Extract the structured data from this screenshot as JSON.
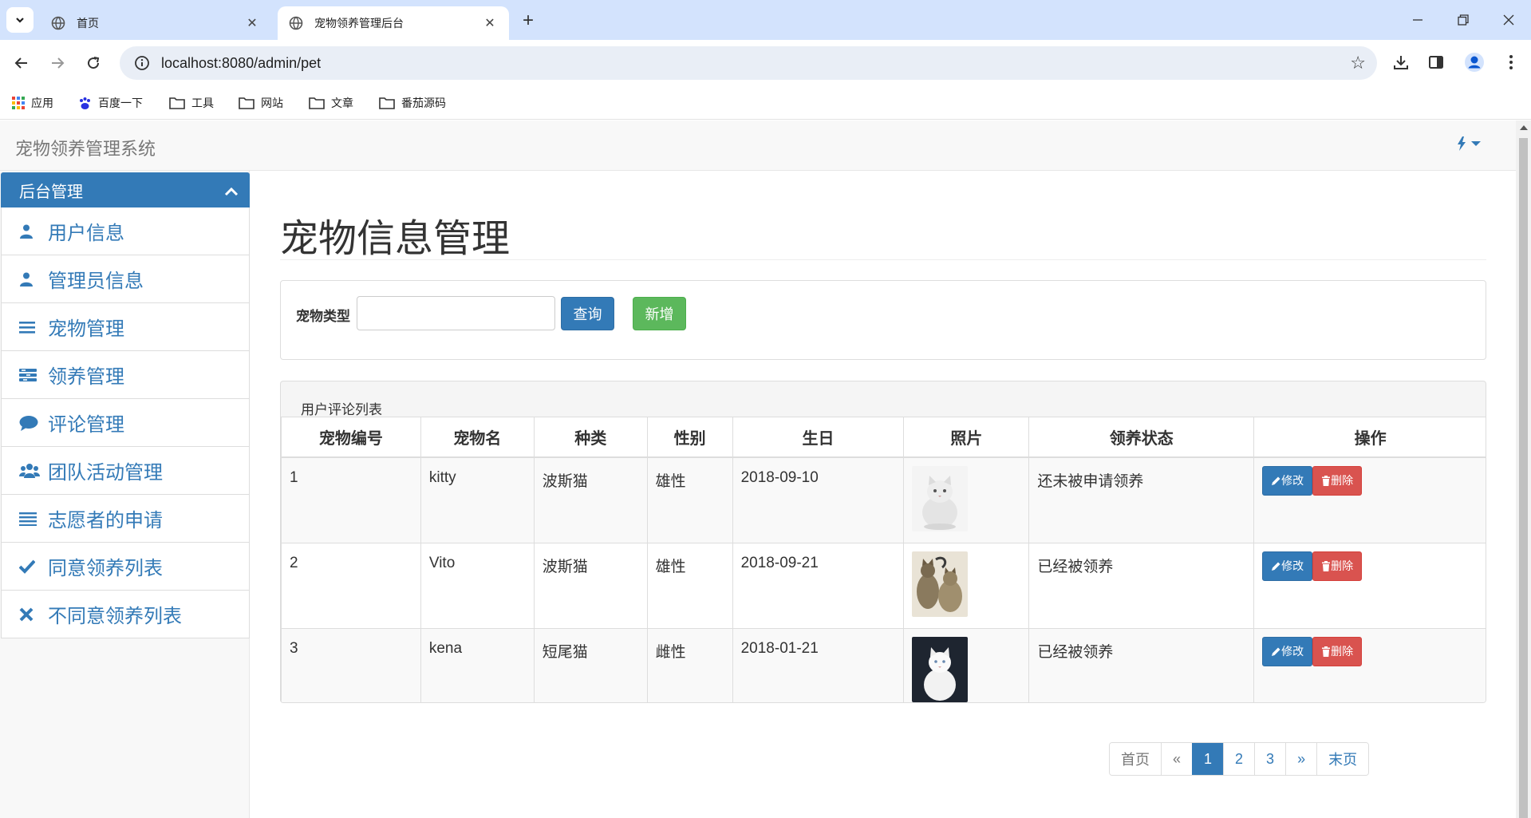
{
  "browser": {
    "tabs": [
      {
        "title": "首页",
        "active": false
      },
      {
        "title": "宠物领养管理后台",
        "active": true
      }
    ],
    "url": "localhost:8080/admin/pet",
    "bookmarks": [
      "应用",
      "百度一下",
      "工具",
      "网站",
      "文章",
      "番茄源码"
    ]
  },
  "header": {
    "brand": "宠物领养管理系统"
  },
  "sidebar": {
    "heading": "后台管理",
    "items": [
      {
        "label": "用户信息",
        "icon": "user-icon"
      },
      {
        "label": "管理员信息",
        "icon": "user-icon"
      },
      {
        "label": "宠物管理",
        "icon": "list-icon"
      },
      {
        "label": "领养管理",
        "icon": "tasks-icon"
      },
      {
        "label": "评论管理",
        "icon": "comment-icon"
      },
      {
        "label": "团队活动管理",
        "icon": "group-icon"
      },
      {
        "label": "志愿者的申请",
        "icon": "align-justify-icon"
      },
      {
        "label": "同意领养列表",
        "icon": "check-icon"
      },
      {
        "label": "不同意领养列表",
        "icon": "times-icon"
      }
    ]
  },
  "main": {
    "title": "宠物信息管理",
    "search": {
      "label": "宠物类型",
      "value": "",
      "query_label": "查询",
      "add_label": "新增"
    },
    "list": {
      "caption": "用户评论列表",
      "columns": [
        "宠物编号",
        "宠物名",
        "种类",
        "性别",
        "生日",
        "照片",
        "领养状态",
        "操作"
      ],
      "rows": [
        {
          "id": "1",
          "name": "kitty",
          "type": "波斯猫",
          "sex": "雄性",
          "birthday": "2018-09-10",
          "status": "还未被申请领养"
        },
        {
          "id": "2",
          "name": "Vito",
          "type": "波斯猫",
          "sex": "雄性",
          "birthday": "2018-09-21",
          "status": "已经被领养"
        },
        {
          "id": "3",
          "name": "kena",
          "type": "短尾猫",
          "sex": "雌性",
          "birthday": "2018-01-21",
          "status": "已经被领养"
        }
      ],
      "edit_label": "修改",
      "delete_label": "删除"
    },
    "pager": {
      "first": "首页",
      "prev": "«",
      "pages": [
        "1",
        "2",
        "3"
      ],
      "current": "1",
      "next": "»",
      "last": "末页"
    }
  },
  "colors": {
    "primary": "#337ab7",
    "success": "#5cb85c",
    "danger": "#d9534f",
    "chrome": "#d3e3fd"
  }
}
